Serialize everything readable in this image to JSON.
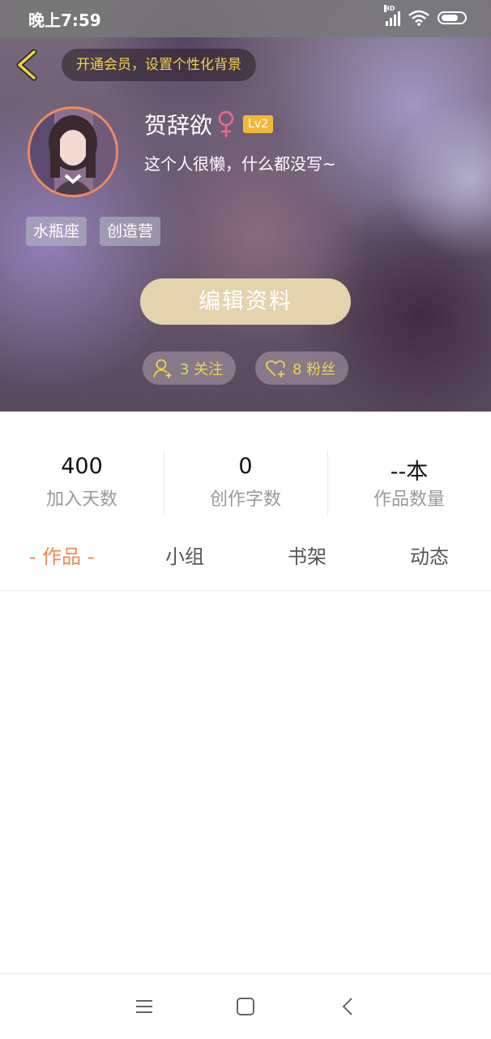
{
  "status_bar": {
    "time": "晚上7:59",
    "signal_label": "HD",
    "icons": [
      "signal-icon",
      "wifi-icon",
      "battery-icon"
    ]
  },
  "header": {
    "vip_banner": "开通会员，设置个性化背景",
    "username": "贺辞欲",
    "gender_symbol": "female",
    "level": "Lv2",
    "bio": "这个人很懒，什么都没写~",
    "tags": [
      "水瓶座",
      "创造营"
    ],
    "edit_button": "编辑资料",
    "follow": "3 关注",
    "fans": "8 粉丝"
  },
  "stats": [
    {
      "value": "400",
      "label": "加入天数"
    },
    {
      "value": "0",
      "label": "创作字数"
    },
    {
      "value": "--本",
      "label": "作品数量"
    }
  ],
  "tabs": [
    {
      "label": "- 作品 -",
      "active": true
    },
    {
      "label": "小组",
      "active": false
    },
    {
      "label": "书架",
      "active": false
    },
    {
      "label": "动态",
      "active": false
    }
  ],
  "colors": {
    "accent": "#f08a54",
    "gold_text": "#f2d24c",
    "edit_button": "#e4d4ae",
    "level_badge": "#f1b93a"
  },
  "nav_bar": [
    "menu-icon",
    "home-icon",
    "back-icon"
  ]
}
